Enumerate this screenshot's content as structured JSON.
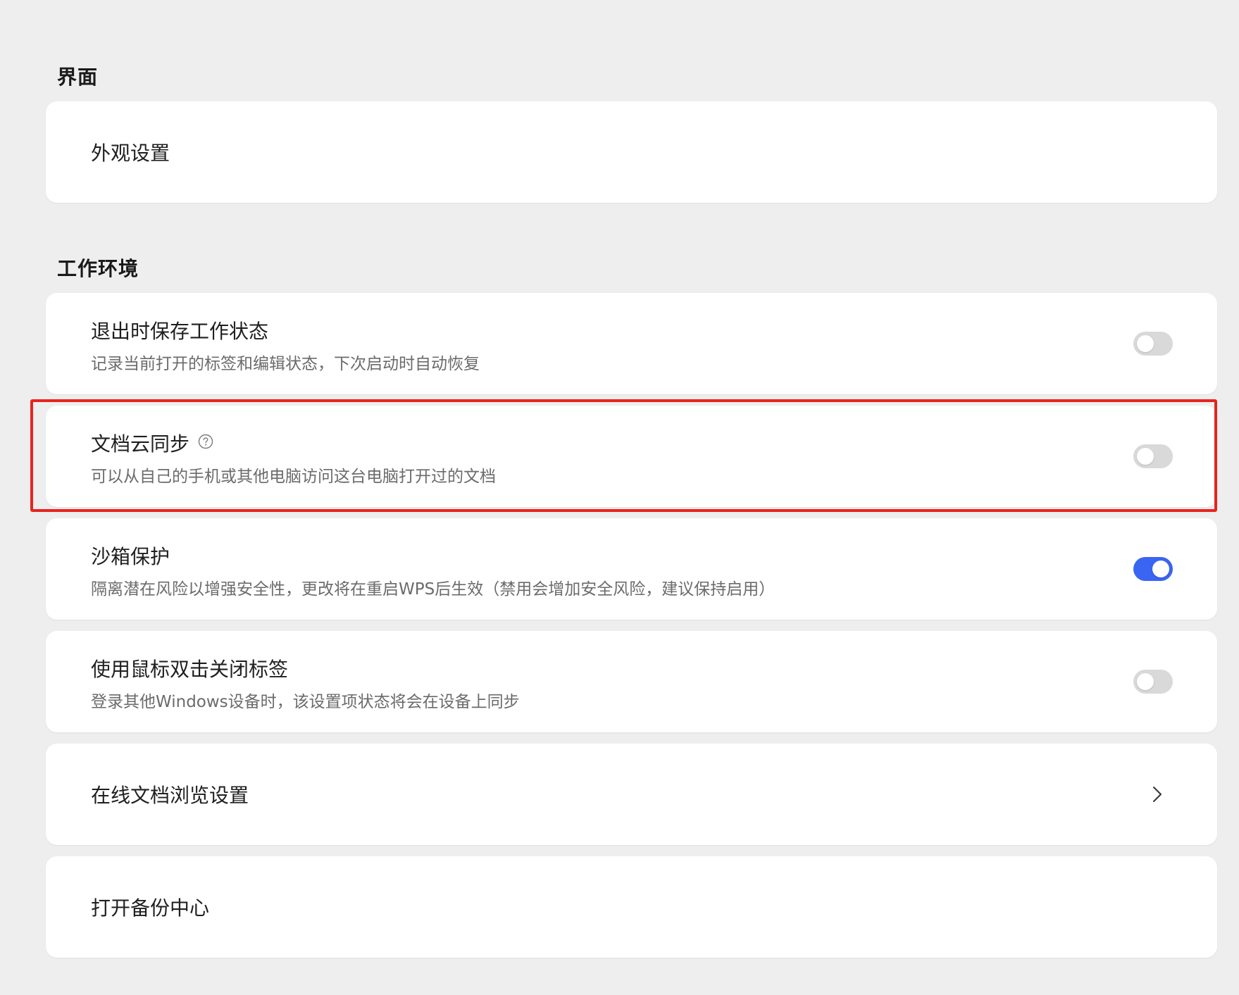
{
  "sections": {
    "interface": {
      "title": "界面",
      "items": {
        "appearance": {
          "title": "外观设置"
        }
      }
    },
    "workspace": {
      "title": "工作环境",
      "items": {
        "save_state": {
          "title": "退出时保存工作状态",
          "desc": "记录当前打开的标签和编辑状态，下次启动时自动恢复",
          "enabled": false
        },
        "cloud_sync": {
          "title": "文档云同步",
          "desc": "可以从自己的手机或其他电脑访问这台电脑打开过的文档",
          "enabled": false,
          "help_icon": "question-circle-icon"
        },
        "sandbox": {
          "title": "沙箱保护",
          "desc": "隔离潜在风险以增强安全性，更改将在重启WPS后生效（禁用会增加安全风险，建议保持启用）",
          "enabled": true
        },
        "double_click_close": {
          "title": "使用鼠标双击关闭标签",
          "desc": "登录其他Windows设备时，该设置项状态将会在设备上同步",
          "enabled": false
        },
        "online_doc_browse": {
          "title": "在线文档浏览设置",
          "icon": "chevron-right-icon"
        },
        "backup_center": {
          "title": "打开备份中心"
        }
      }
    }
  },
  "colors": {
    "background": "#eeeeee",
    "card": "#ffffff",
    "toggle_on": "#3a64f2",
    "toggle_off": "#d9d9d9",
    "highlight": "#e8231e"
  }
}
